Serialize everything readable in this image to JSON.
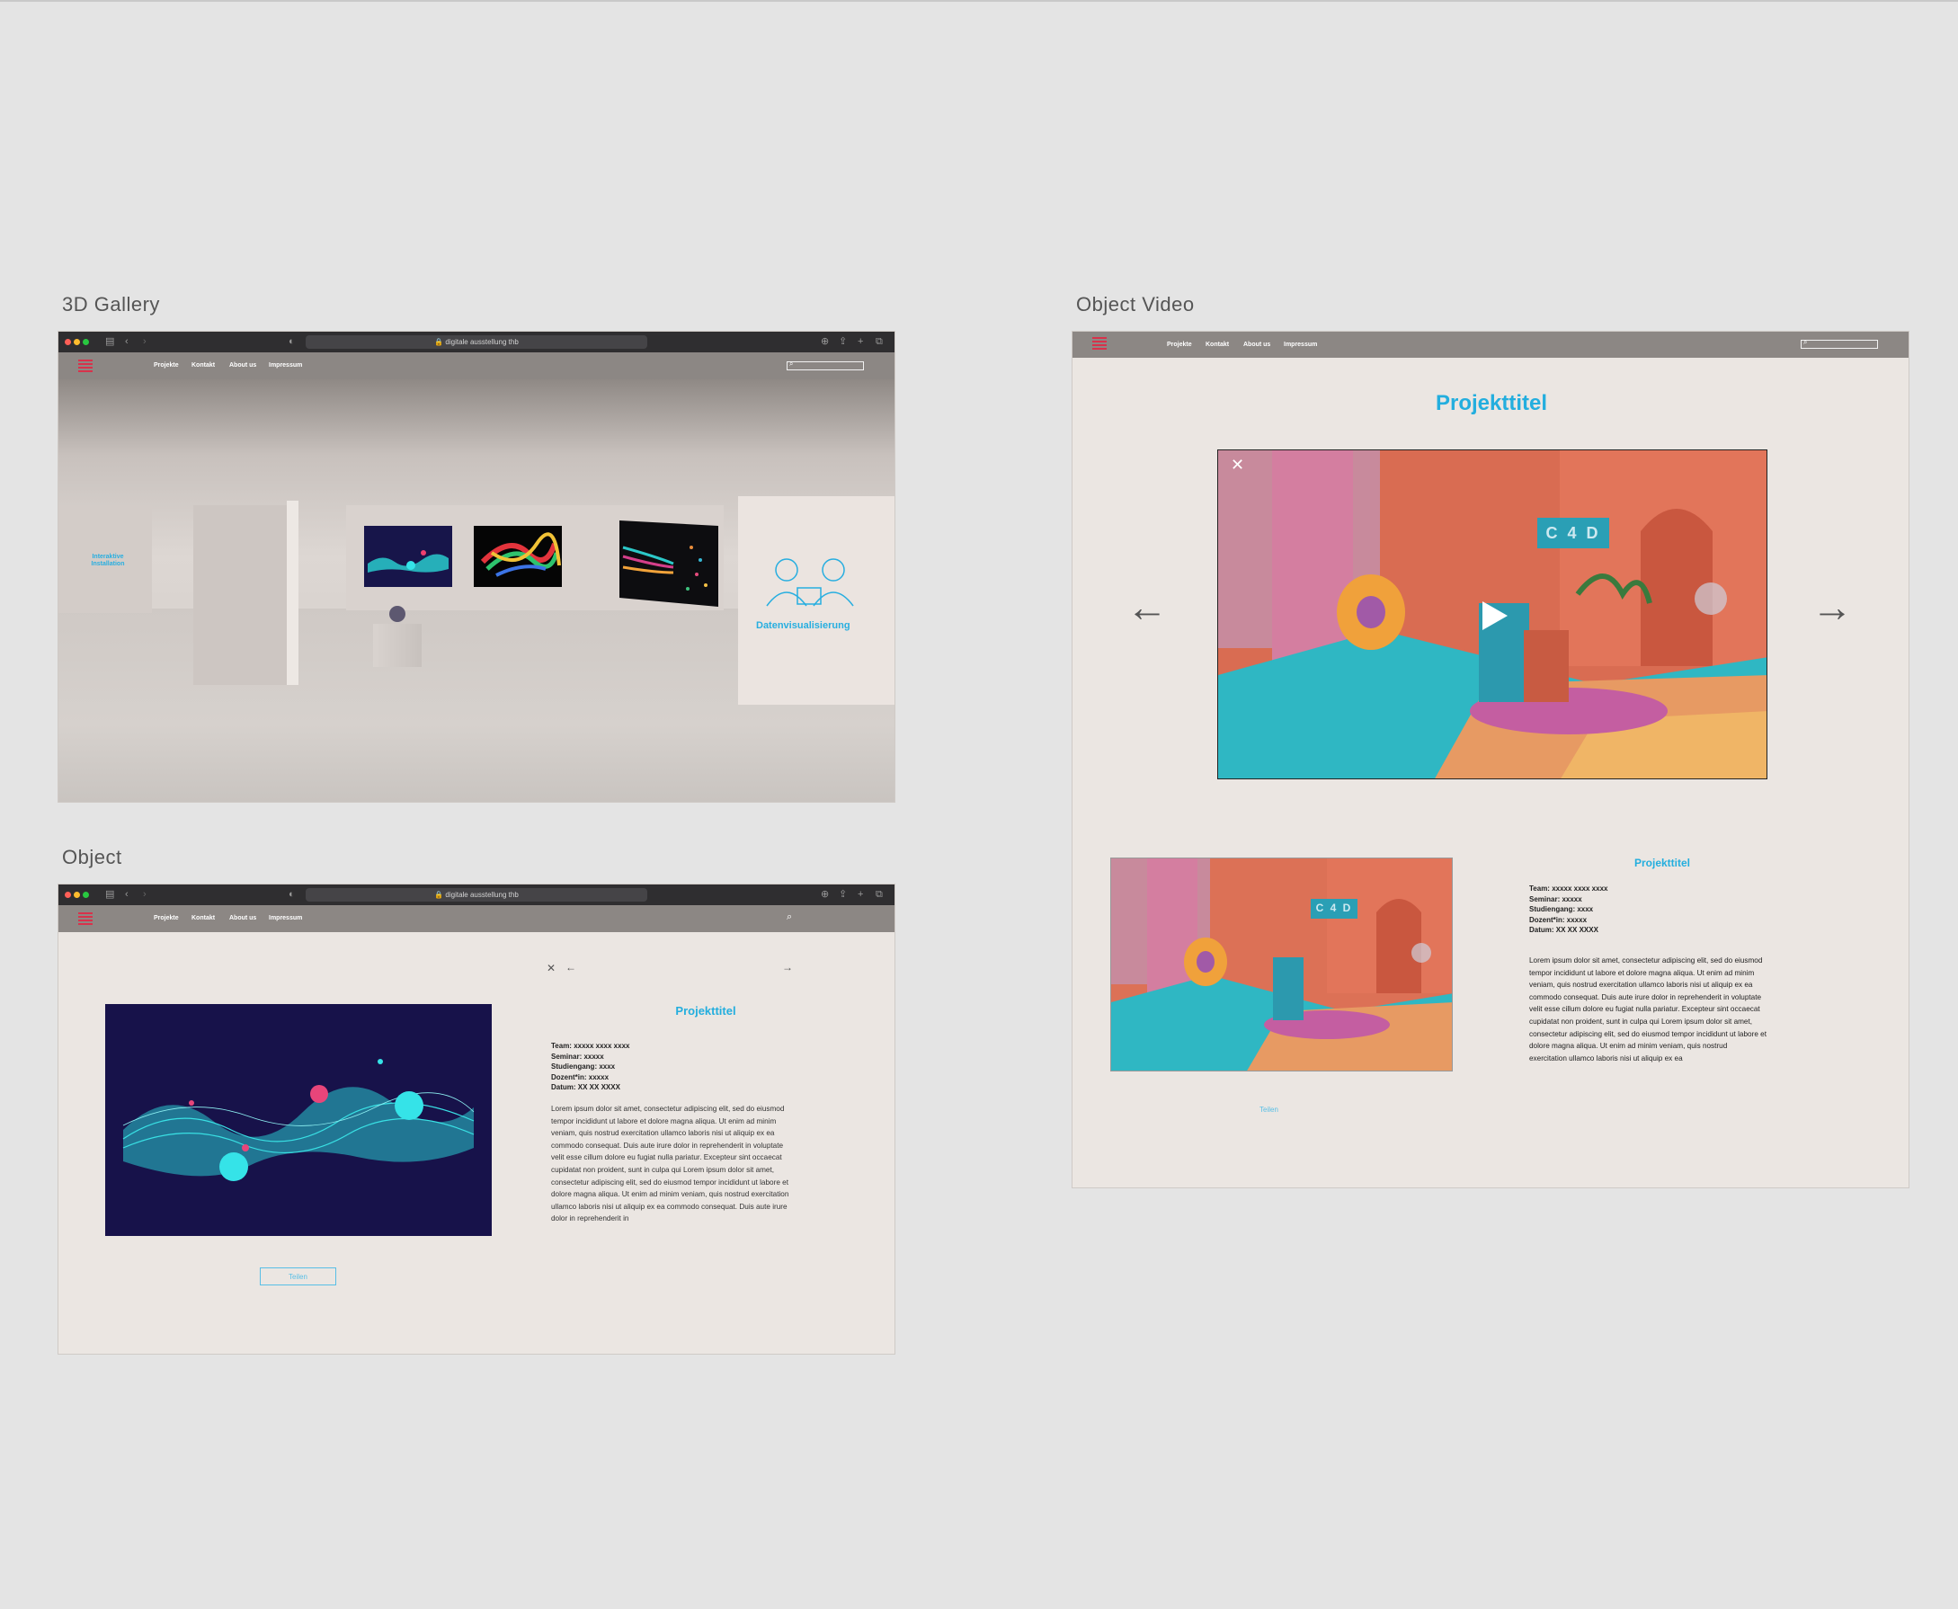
{
  "frames": {
    "gallery_label": "3D Gallery",
    "object_label": "Object",
    "video_label": "Object Video"
  },
  "browser": {
    "url": "digitale ausstellung thb"
  },
  "nav": {
    "items": [
      "Projekte",
      "Kontakt",
      "About us",
      "Impressum"
    ]
  },
  "gallery": {
    "wall_left_text": "Interaktive Installation",
    "wall_right_text": "Datenvisualisierung"
  },
  "object": {
    "title": "Projekttitel",
    "meta": [
      "Team: xxxxx xxxx xxxx",
      "Seminar: xxxxx",
      "Studiengang: xxxx",
      "Dozent*in: xxxxx",
      "Datum: XX XX XXXX"
    ],
    "body": "Lorem ipsum dolor sit amet, consectetur adipiscing elit, sed do eiusmod tempor incididunt ut labore et dolore magna aliqua. Ut enim ad minim veniam, quis nostrud exercitation ullamco laboris nisi ut aliquip ex ea commodo consequat. Duis aute irure dolor in reprehenderit in voluptate velit esse cillum dolore eu fugiat nulla pariatur. Excepteur sint occaecat cupidatat non proident, sunt in culpa qui Lorem ipsum dolor sit amet, consectetur adipiscing elit, sed do eiusmod tempor incididunt ut labore et dolore magna aliqua. Ut enim ad minim veniam, quis nostrud exercitation ullamco laboris nisi ut aliquip ex ea commodo consequat. Duis aute irure dolor in reprehenderit in",
    "share_label": "Teilen"
  },
  "video": {
    "title": "Projekttitel",
    "video_sign": "C 4 D",
    "sub_title": "Projekttitel",
    "meta": [
      "Team: xxxxx xxxx xxxx",
      "Seminar: xxxxx",
      "Studiengang: xxxx",
      "Dozent*in: xxxxx",
      "Datum: XX XX XXXX"
    ],
    "body": "Lorem ipsum dolor sit amet, consectetur adipiscing elit, sed do eiusmod tempor incididunt ut labore et dolore magna aliqua. Ut enim ad minim veniam, quis nostrud exercitation ullamco laboris nisi ut aliquip ex ea commodo consequat. Duis aute irure dolor in reprehenderit in voluptate velit esse cillum dolore eu fugiat nulla pariatur. Excepteur sint occaecat cupidatat non proident, sunt in culpa qui Lorem ipsum dolor sit amet, consectetur adipiscing elit, sed do eiusmod tempor incididunt ut labore et dolore magna aliqua. Ut enim ad minim veniam, quis nostrud exercitation ullamco laboris nisi ut aliquip ex ea",
    "share_label": "Teilen"
  },
  "colors": {
    "accent": "#27aee0",
    "nav_bg": "#8c8784",
    "page_bg": "#ebe6e2",
    "logo": "#d8324b"
  }
}
